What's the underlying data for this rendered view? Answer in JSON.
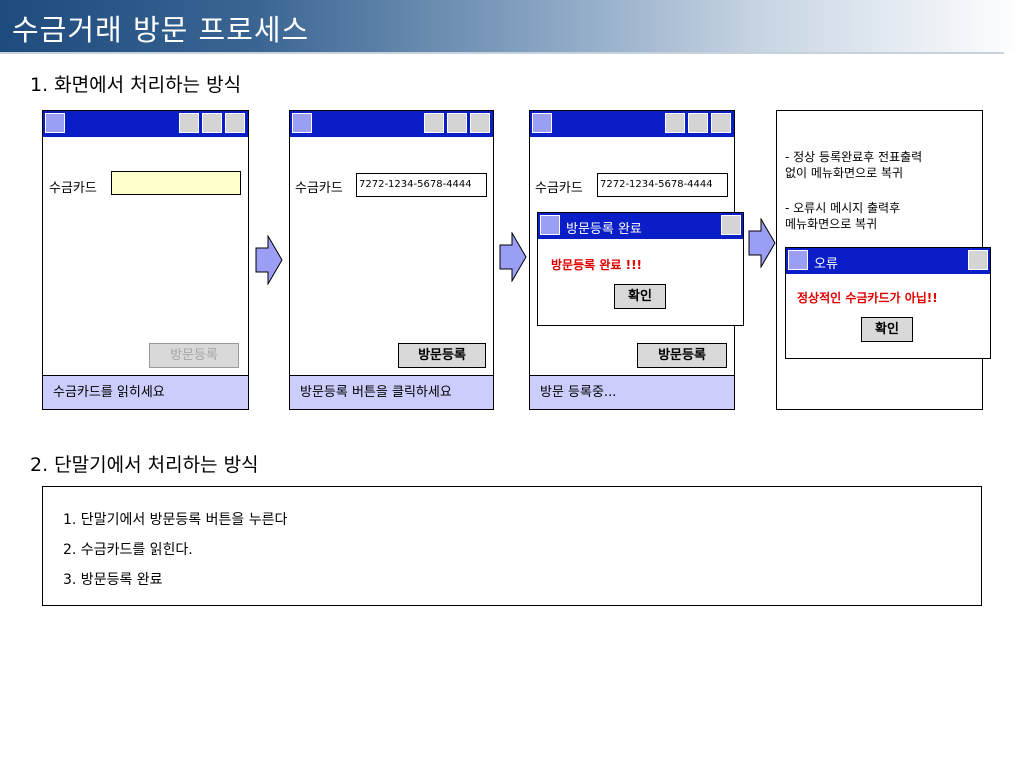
{
  "page_title": "수금거래 방문 프로세스",
  "section1": {
    "heading": "1. 화면에서 처리하는 방식"
  },
  "section2": {
    "heading": "2. 단말기에서 처리하는 방식"
  },
  "screens": {
    "s1": {
      "card_label": "수금카드",
      "card_value": "",
      "button": "방문등록",
      "status": "수금카드를 읽히세요"
    },
    "s2": {
      "card_label": "수금카드",
      "card_value": "7272-1234-5678-4444",
      "button": "방문등록",
      "status": "방문등록 버튼을 클릭하세요"
    },
    "s3": {
      "card_label": "수금카드",
      "card_value": "7272-1234-5678-4444",
      "button": "방문등록",
      "status": "방문 등록중...",
      "dialog": {
        "title": "방문등록 완료",
        "message": "방문등록 완료 !!!",
        "ok": "확인"
      }
    },
    "s4": {
      "note1_line1": "- 정상 등록완료후 전표출력",
      "note1_line2": "없이 메뉴화면으로 복귀",
      "note2_line1": "- 오류시 메시지 출력후",
      "note2_line2": "메뉴화면으로 복귀",
      "dialog": {
        "title": "오류",
        "message": "정상적인 수금카드가 아닙!!",
        "ok": "확인"
      }
    }
  },
  "steps": [
    "1. 단말기에서 방문등록 버튼을 누른다",
    "2. 수금카드를 읽힌다.",
    "3. 방문등록 완료"
  ],
  "colors": {
    "titlebar_blue": "#0a1ec8",
    "status_bg": "#cccdfc",
    "card_input_bg": "#ffffcc",
    "error_red": "#e00000",
    "arrow_fill": "#9a9ef4"
  }
}
